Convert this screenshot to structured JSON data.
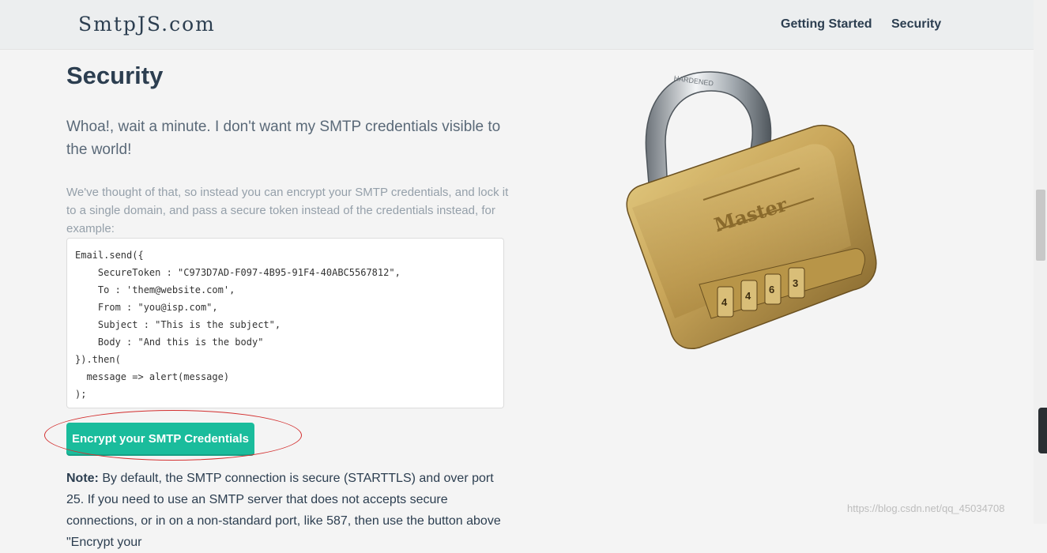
{
  "navbar": {
    "brand": "SmtpJS.com",
    "links": [
      "Getting Started",
      "Security"
    ]
  },
  "section": {
    "title": "Security",
    "lead": "Whoa!, wait a minute. I don't want my SMTP credentials visible to the world!",
    "intro": "We've thought of that, so instead you can encrypt your SMTP credentials, and lock it to a single domain, and pass a secure token instead of the credentials instead, for example:",
    "code_lines": [
      "Email.send({",
      "    SecureToken : \"C973D7AD-F097-4B95-91F4-40ABC5567812\",",
      "    To : 'them@website.com',",
      "    From : \"you@isp.com\",",
      "    Subject : \"This is the subject\",",
      "    Body : \"And this is the body\"",
      "}).then(",
      "  message => alert(message)",
      ");"
    ],
    "encrypt_button": "Encrypt your SMTP Credentials",
    "note_label": "Note:",
    "note_text": " By default, the SMTP connection is secure (STARTTLS) and over port 25. If you need to use an SMTP server that does not accepts secure connections, or in on a non-standard port, like 587, then use the button above \"Encrypt your"
  },
  "lock_image": {
    "brand_text": "Master",
    "shackle_text": "HARDENED",
    "dial_digits": [
      "4",
      "4",
      "6",
      "3"
    ]
  },
  "watermark": "https://blog.csdn.net/qq_45034708",
  "colors": {
    "accent": "#1abc9c",
    "heading": "#2c3e50",
    "annotation": "#d32f2f"
  }
}
